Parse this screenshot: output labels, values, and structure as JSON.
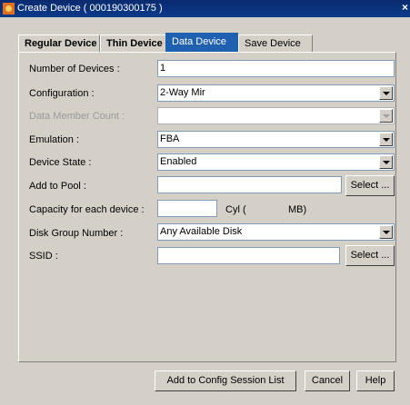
{
  "window": {
    "title": "Create Device ( 000190300175 )",
    "close_glyph": "×"
  },
  "tabs": [
    {
      "label": "Regular Device"
    },
    {
      "label": "Thin Device"
    },
    {
      "label": "Data Device"
    },
    {
      "label": "Save Device"
    }
  ],
  "form": {
    "number_of_devices": {
      "label": "Number of Devices :",
      "value": "1"
    },
    "configuration": {
      "label": "Configuration :",
      "value": "2-Way Mir"
    },
    "data_member_count": {
      "label": "Data Member Count :",
      "value": ""
    },
    "emulation": {
      "label": "Emulation :",
      "value": "FBA"
    },
    "device_state": {
      "label": "Device State :",
      "value": "Enabled"
    },
    "add_to_pool": {
      "label": "Add to Pool :",
      "value": "",
      "button": "Select ..."
    },
    "capacity": {
      "label": "Capacity for each device :",
      "value": "",
      "cyl_text": "Cyl  (",
      "mb_text": "MB)"
    },
    "disk_group": {
      "label": "Disk Group Number :",
      "value": "Any Available Disk"
    },
    "ssid": {
      "label": "SSID :",
      "value": "",
      "button": "Select ..."
    }
  },
  "footer": {
    "add_button": "Add to Config Session List",
    "cancel_button": "Cancel",
    "help_button": "Help"
  }
}
